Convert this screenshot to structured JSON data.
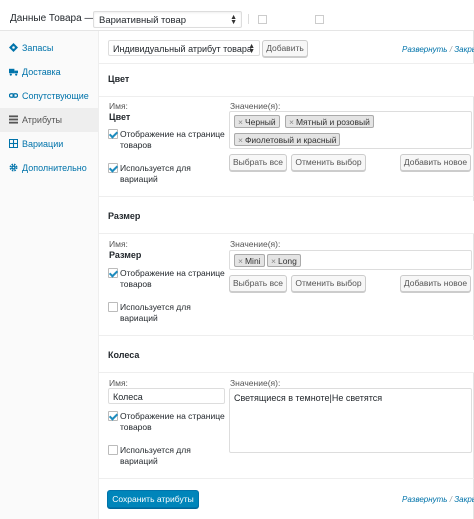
{
  "header": {
    "title": "Данные Товара —",
    "product_type": "Вариативный товар"
  },
  "sidebar": {
    "items": [
      {
        "label": "Запасы",
        "icon": "inventory-icon"
      },
      {
        "label": "Доставка",
        "icon": "truck-icon"
      },
      {
        "label": "Сопутствующие",
        "icon": "link-icon"
      },
      {
        "label": "Атрибуты",
        "icon": "list-icon"
      },
      {
        "label": "Вариации",
        "icon": "grid-icon"
      },
      {
        "label": "Дополнительно",
        "icon": "gear-icon"
      }
    ],
    "active_index": 3
  },
  "toolbar": {
    "attribute_select": "Индивидуальный атрибут товара",
    "add_label": "Добавить",
    "expand_label": "Развернуть",
    "separator": "/",
    "collapse_label": "Закрыть"
  },
  "attributes": [
    {
      "title": "Цвет",
      "name_label": "Имя:",
      "name_value": "Цвет",
      "values_label": "Значение(я):",
      "tags": [
        "Черный",
        "Мятный и розовый",
        "Фиолетовый и красный"
      ],
      "visible_label_1": "Отображение на странице",
      "visible_label_2": "товаров",
      "visible_checked": true,
      "variation_label_1": "Используется для",
      "variation_label_2": "вариаций",
      "variation_checked": true,
      "select_all": "Выбрать все",
      "select_none": "Отменить выбор",
      "add_new": "Добавить новое"
    },
    {
      "title": "Размер",
      "name_label": "Имя:",
      "name_value": "Размер",
      "values_label": "Значение(я):",
      "tags": [
        "Mini",
        "Long"
      ],
      "visible_label_1": "Отображение на странице",
      "visible_label_2": "товаров",
      "visible_checked": true,
      "variation_label_1": "Используется для",
      "variation_label_2": "вариаций",
      "variation_checked": false,
      "select_all": "Выбрать все",
      "select_none": "Отменить выбор",
      "add_new": "Добавить новое"
    },
    {
      "title": "Колеса",
      "name_label": "Имя:",
      "name_value": "Колеса",
      "values_label": "Значение(я):",
      "values_text": "Светящиеся в темноте|Не светятся",
      "visible_label_1": "Отображение на странице",
      "visible_label_2": "товаров",
      "visible_checked": true,
      "variation_label_1": "Используется для",
      "variation_label_2": "вариаций",
      "variation_checked": false
    }
  ],
  "footer": {
    "save_label": "Сохранить атрибуты",
    "expand_label": "Развернуть",
    "separator": "/",
    "collapse_label": "Закрыть"
  },
  "colors": {
    "accent": "#0073aa",
    "primary_button": "#0085ba"
  }
}
